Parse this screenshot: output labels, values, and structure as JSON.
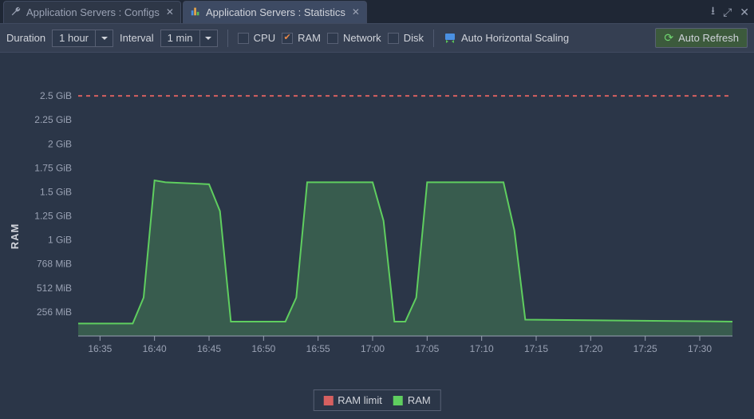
{
  "tabs": [
    {
      "label": "Application Servers : Configs",
      "active": false
    },
    {
      "label": "Application Servers : Statistics",
      "active": true
    }
  ],
  "toolbar": {
    "duration_label": "Duration",
    "duration_value": "1 hour",
    "interval_label": "Interval",
    "interval_value": "1 min",
    "checks": {
      "cpu": {
        "label": "CPU",
        "checked": false
      },
      "ram": {
        "label": "RAM",
        "checked": true
      },
      "network": {
        "label": "Network",
        "checked": false
      },
      "disk": {
        "label": "Disk",
        "checked": false
      }
    },
    "ahs_label": "Auto Horizontal Scaling",
    "refresh_label": "Auto Refresh"
  },
  "chart": {
    "ylabel": "RAM",
    "y_ticks": [
      "256 MiB",
      "512 MiB",
      "768 MiB",
      "1 GiB",
      "1.25 GiB",
      "1.5 GiB",
      "1.75 GiB",
      "2 GiB",
      "2.25 GiB",
      "2.5 GiB"
    ],
    "x_ticks": [
      "16:35",
      "16:40",
      "16:45",
      "16:50",
      "16:55",
      "17:00",
      "17:05",
      "17:10",
      "17:15",
      "17:20",
      "17:25",
      "17:30"
    ],
    "legend": [
      {
        "label": "RAM limit",
        "swatch": "#d66060"
      },
      {
        "label": "RAM",
        "swatch": "#5fce5f"
      }
    ]
  },
  "chart_data": {
    "type": "area",
    "title": "",
    "xlabel": "",
    "ylabel": "RAM",
    "x_range_minutes": [
      0,
      60
    ],
    "x_tick_labels": [
      "16:35",
      "16:40",
      "16:45",
      "16:50",
      "16:55",
      "17:00",
      "17:05",
      "17:10",
      "17:15",
      "17:20",
      "17:25",
      "17:30"
    ],
    "y_unit": "GiB",
    "y_range": [
      0,
      2.7
    ],
    "y_tick_labels": [
      "256 MiB",
      "512 MiB",
      "768 MiB",
      "1 GiB",
      "1.25 GiB",
      "1.5 GiB",
      "1.75 GiB",
      "2 GiB",
      "2.25 GiB",
      "2.5 GiB"
    ],
    "series": [
      {
        "name": "RAM limit",
        "color": "#d66060",
        "style": "dashed",
        "fill": false,
        "points": [
          {
            "t": 0,
            "v": 2.5
          },
          {
            "t": 60,
            "v": 2.5
          }
        ]
      },
      {
        "name": "RAM",
        "color": "#5fce5f",
        "style": "solid",
        "fill": true,
        "points": [
          {
            "t": 0,
            "v": 0.13
          },
          {
            "t": 4,
            "v": 0.13
          },
          {
            "t": 5,
            "v": 0.13
          },
          {
            "t": 6,
            "v": 0.4
          },
          {
            "t": 7,
            "v": 1.62
          },
          {
            "t": 8,
            "v": 1.6
          },
          {
            "t": 12,
            "v": 1.58
          },
          {
            "t": 13,
            "v": 1.3
          },
          {
            "t": 14,
            "v": 0.15
          },
          {
            "t": 18,
            "v": 0.15
          },
          {
            "t": 19,
            "v": 0.15
          },
          {
            "t": 20,
            "v": 0.4
          },
          {
            "t": 21,
            "v": 1.6
          },
          {
            "t": 27,
            "v": 1.6
          },
          {
            "t": 28,
            "v": 1.2
          },
          {
            "t": 29,
            "v": 0.15
          },
          {
            "t": 30,
            "v": 0.15
          },
          {
            "t": 31,
            "v": 0.4
          },
          {
            "t": 32,
            "v": 1.6
          },
          {
            "t": 39,
            "v": 1.6
          },
          {
            "t": 40,
            "v": 1.1
          },
          {
            "t": 41,
            "v": 0.17
          },
          {
            "t": 60,
            "v": 0.15
          }
        ]
      }
    ]
  }
}
